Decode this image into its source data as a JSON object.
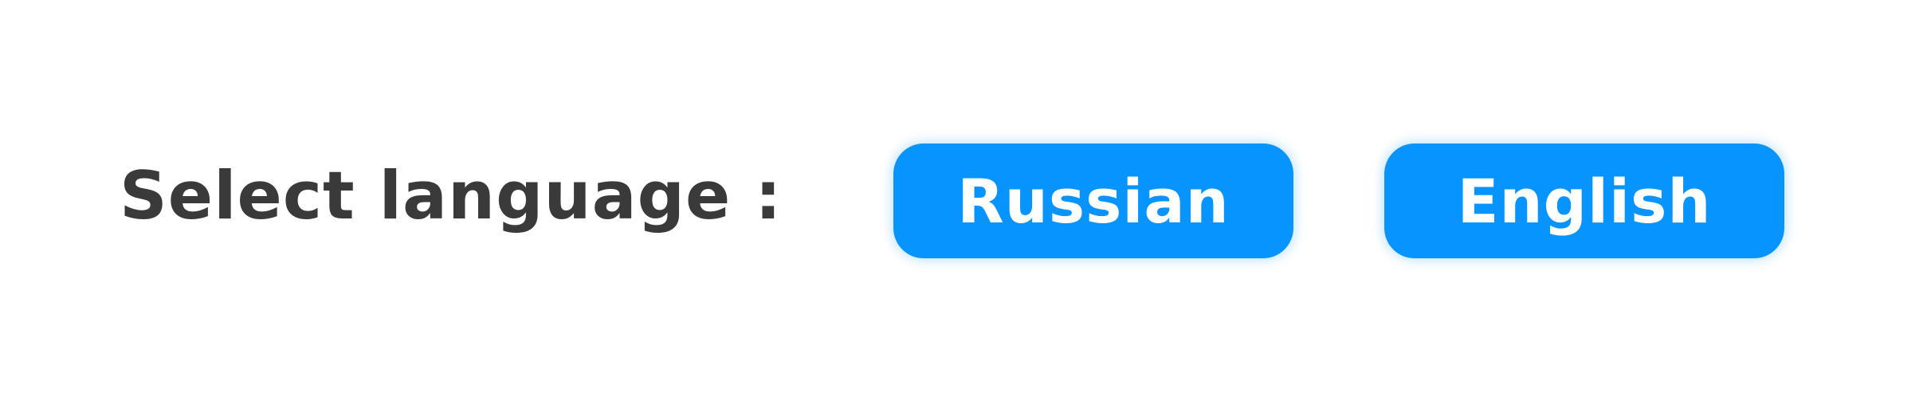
{
  "prompt": {
    "label": "Select language :"
  },
  "languages": [
    {
      "label": "Russian"
    },
    {
      "label": "English"
    }
  ],
  "colors": {
    "accent": "#0894ff",
    "text": "#3a3a3a",
    "button_text": "#ffffff",
    "background": "#ffffff"
  }
}
